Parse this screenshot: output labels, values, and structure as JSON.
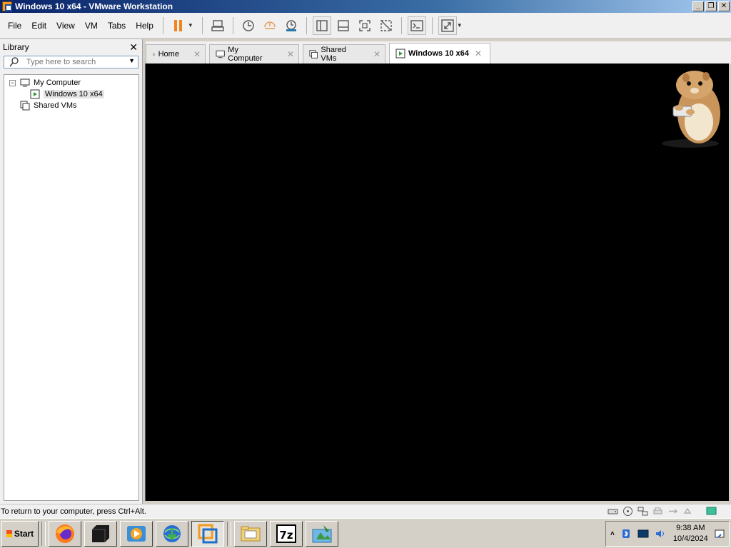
{
  "window": {
    "title": "Windows 10 x64 - VMware Workstation"
  },
  "menu": [
    "File",
    "Edit",
    "View",
    "VM",
    "Tabs",
    "Help"
  ],
  "library": {
    "title": "Library",
    "search_placeholder": "Type here to search",
    "tree": {
      "root": "My Computer",
      "child": "Windows 10 x64",
      "shared": "Shared VMs"
    }
  },
  "tabs": [
    {
      "label": "Home",
      "icon": "home-icon"
    },
    {
      "label": "My Computer",
      "icon": "computer-icon"
    },
    {
      "label": "Shared VMs",
      "icon": "shared-vms-icon"
    },
    {
      "label": "Windows 10 x64",
      "icon": "vm-running-icon",
      "active": true
    }
  ],
  "status": {
    "message": "To return to your computer, press Ctrl+Alt."
  },
  "taskbar": {
    "start": "Start",
    "apps": [
      "firefox-icon",
      "terminal-icon",
      "media-player-icon",
      "internet-download-manager-icon",
      "vmware-icon",
      "file-explorer-icon",
      "7zip-icon",
      "image-editor-icon"
    ],
    "clock_time": "9:38 AM",
    "clock_date": "10/4/2024"
  },
  "colors": {
    "titlebar": "#0a246a",
    "pause_accent": "#f0841e",
    "vm_screen": "#000000"
  }
}
